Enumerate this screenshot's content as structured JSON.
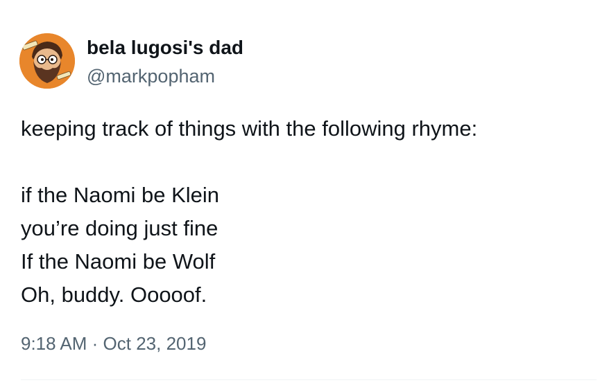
{
  "author": {
    "display_name": "bela lugosi's dad",
    "handle": "@markpopham",
    "avatar_icon": "cartoon-bearded-man-avatar",
    "avatar_bg": "#e8862b"
  },
  "tweet": {
    "lines": [
      "keeping track of things with the following rhyme:",
      "",
      "if the Naomi be Klein",
      "you’re doing just fine",
      "If the Naomi be Wolf",
      "Oh, buddy. Ooooof."
    ]
  },
  "meta": {
    "time": "9:18 AM",
    "separator": "·",
    "date": "Oct 23, 2019"
  },
  "colors": {
    "text": "#0f1419",
    "secondary": "#536471",
    "divider": "#eff3f4"
  }
}
